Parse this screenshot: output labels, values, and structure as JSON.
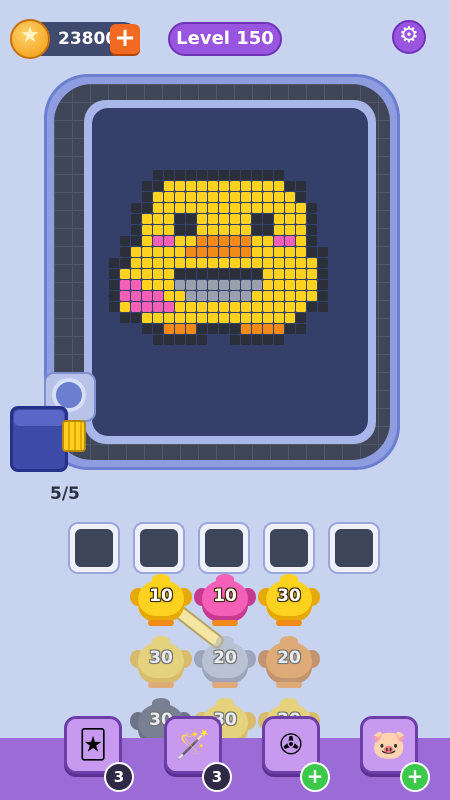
{
  "header": {
    "coins": "23800",
    "add_label": "+",
    "level": "Level 150",
    "coin_icon": "star-coin-icon",
    "settings_icon": "gear-icon"
  },
  "board": {
    "pixel_art": "yellow-chick",
    "colors": {
      "yellow": "#ffd21f",
      "orange": "#f28a17",
      "pink": "#f45fb8",
      "gray": "#9aa0ae",
      "black": "#2b2f3a"
    }
  },
  "shooter": {
    "ammo_count": "5/5"
  },
  "slots": {
    "count": 5
  },
  "birds": [
    {
      "color": "yellow",
      "value": "10",
      "active": true
    },
    {
      "color": "pink",
      "value": "10",
      "active": true
    },
    {
      "color": "yellow",
      "value": "30",
      "active": true
    },
    {
      "color": "yellow",
      "value": "30",
      "active": false
    },
    {
      "color": "gray",
      "value": "20",
      "active": false
    },
    {
      "color": "orange",
      "value": "20",
      "active": false
    },
    {
      "color": "black",
      "value": "30",
      "active": false
    },
    {
      "color": "yellow",
      "value": "30",
      "active": false
    },
    {
      "color": "yellow",
      "value": "20",
      "active": false
    }
  ],
  "powerups": [
    {
      "name": "add-cards",
      "icon": "cards-plus-icon",
      "badge": "3"
    },
    {
      "name": "magic-wand",
      "icon": "wand-icon",
      "badge": "3"
    },
    {
      "name": "fan",
      "icon": "fan-icon",
      "badge": "+"
    },
    {
      "name": "pig",
      "icon": "pig-icon",
      "badge": "+"
    }
  ]
}
